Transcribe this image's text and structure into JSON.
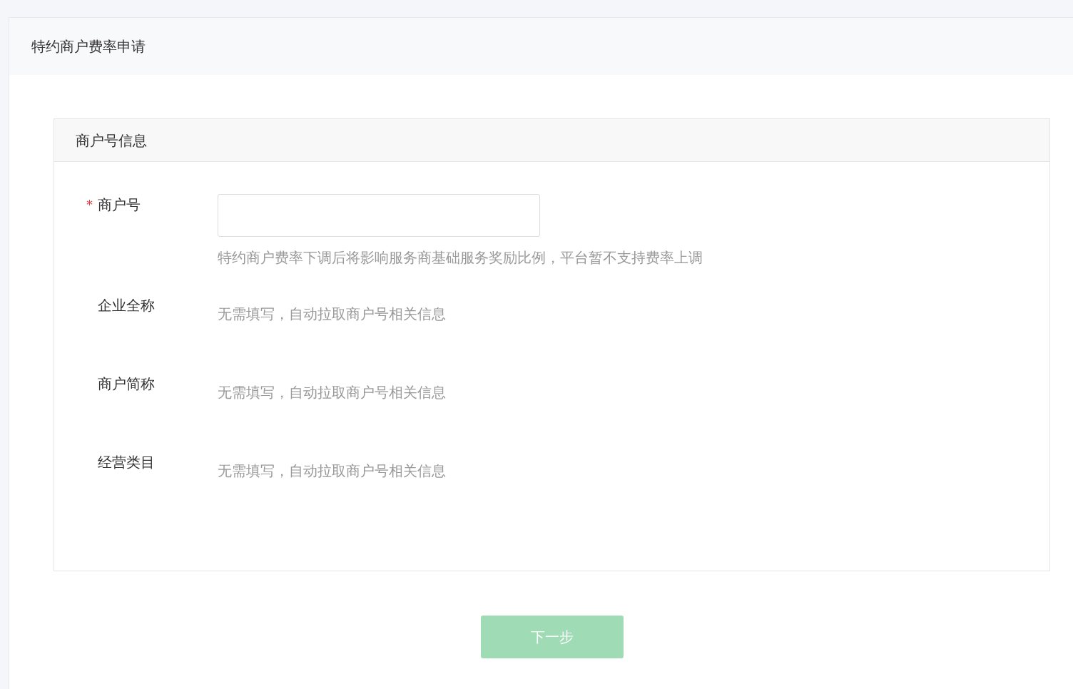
{
  "page": {
    "title": "特约商户费率申请"
  },
  "section": {
    "title": "商户号信息"
  },
  "fields": [
    {
      "kind": "input",
      "label": "商户号",
      "required_mark": "*",
      "hint": "特约商户费率下调后将影响服务商基础服务奖励比例，平台暂不支持费率上调"
    },
    {
      "kind": "auto",
      "label": "企业全称",
      "note": "无需填写，自动拉取商户号相关信息"
    },
    {
      "kind": "auto",
      "label": "商户简称",
      "note": "无需填写，自动拉取商户号相关信息"
    },
    {
      "kind": "auto",
      "label": "经营类目",
      "note": "无需填写，自动拉取商户号相关信息"
    }
  ],
  "button": {
    "label": "下一步",
    "disabled": true
  }
}
